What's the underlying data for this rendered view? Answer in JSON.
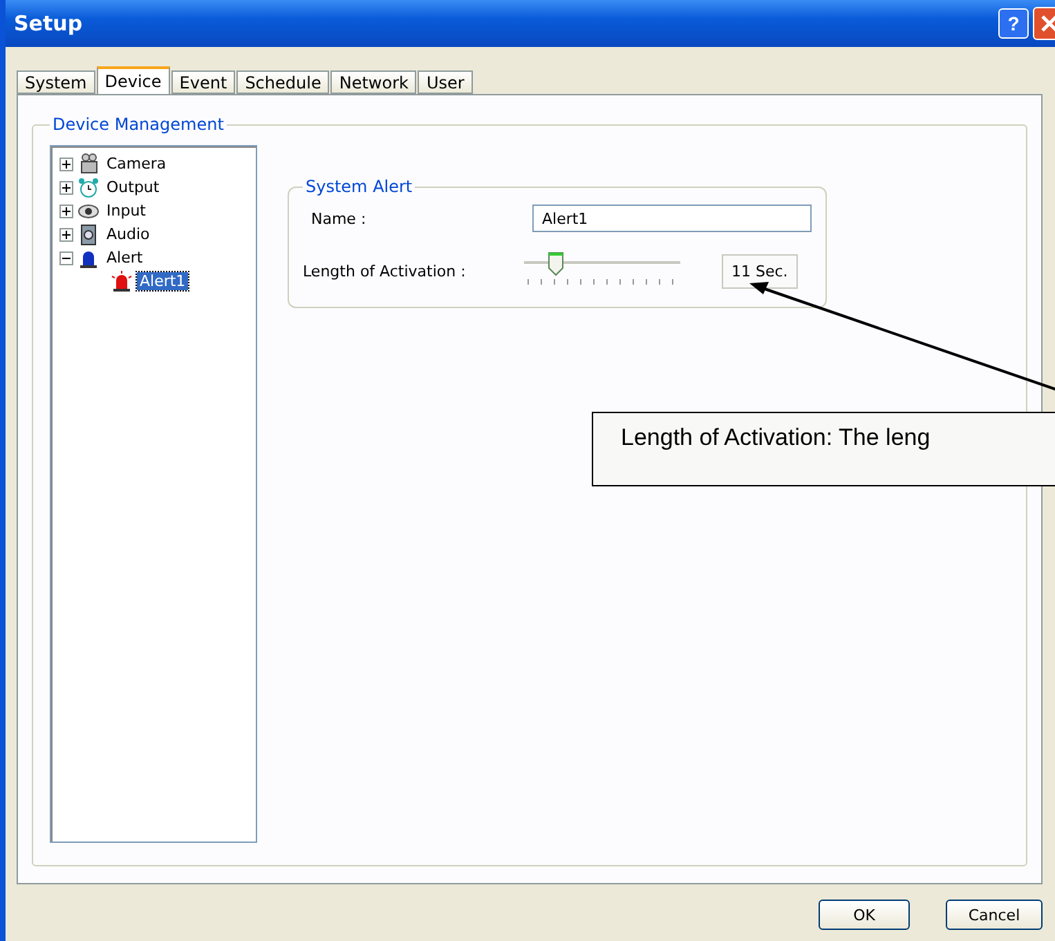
{
  "window": {
    "title": "Setup",
    "help_button": "?"
  },
  "tabs": [
    {
      "label": "System",
      "selected": false
    },
    {
      "label": "Device",
      "selected": true
    },
    {
      "label": "Event",
      "selected": false
    },
    {
      "label": "Schedule",
      "selected": false
    },
    {
      "label": "Network",
      "selected": false
    },
    {
      "label": "User",
      "selected": false
    }
  ],
  "device_management": {
    "title": "Device Management",
    "tree": [
      {
        "label": "Camera",
        "kind": "camera",
        "expanded": false,
        "selected": false
      },
      {
        "label": "Output",
        "kind": "clock",
        "expanded": false,
        "selected": false
      },
      {
        "label": "Input",
        "kind": "eye",
        "expanded": false,
        "selected": false
      },
      {
        "label": "Audio",
        "kind": "speaker",
        "expanded": false,
        "selected": false
      },
      {
        "label": "Alert",
        "kind": "siren",
        "expanded": true,
        "selected": false,
        "children": [
          {
            "label": "Alert1",
            "kind": "siren_active",
            "selected": true
          }
        ]
      }
    ]
  },
  "system_alert": {
    "title": "System Alert",
    "name_label": "Name :",
    "name_value": "Alert1",
    "length_label": "Length of Activation :",
    "length_slider": {
      "level": 0.2
    },
    "length_reading": "11 Sec."
  },
  "buttons": [
    "OK",
    "Cancel"
  ],
  "callout": {
    "text": "Length of Activation: The leng"
  }
}
